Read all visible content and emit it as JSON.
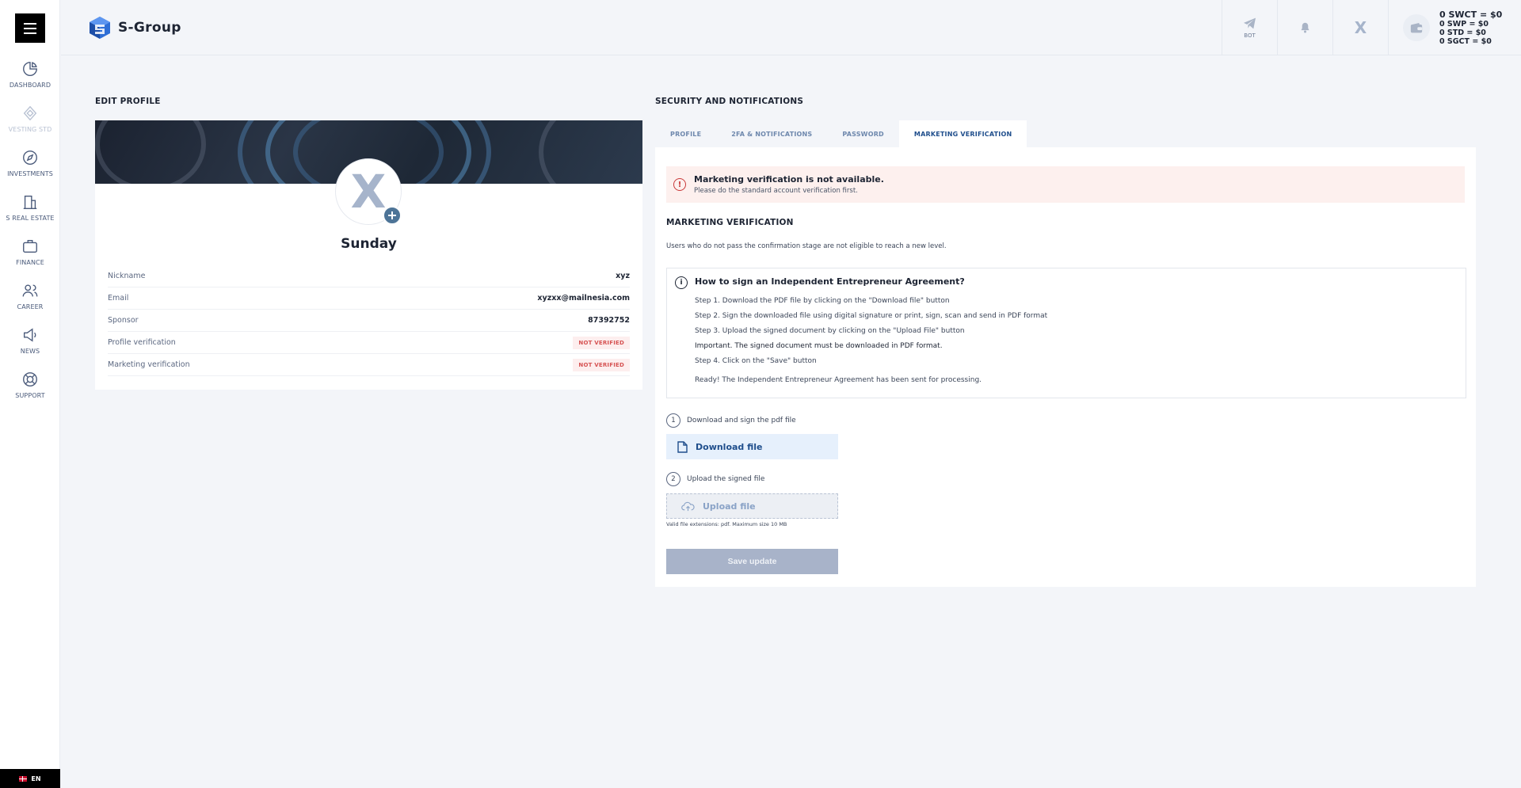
{
  "app": {
    "name": "S-Group"
  },
  "sidebar": {
    "items": [
      {
        "label": "DASHBOARD",
        "icon": "pie-chart-icon"
      },
      {
        "label": "VESTING STD",
        "icon": "diamond-icon",
        "disabled": true
      },
      {
        "label": "INVESTMENTS",
        "icon": "compass-icon"
      },
      {
        "label": "S REAL ESTATE",
        "icon": "building-icon"
      },
      {
        "label": "FINANCE",
        "icon": "briefcase-icon"
      },
      {
        "label": "CAREER",
        "icon": "users-icon"
      },
      {
        "label": "NEWS",
        "icon": "megaphone-icon"
      },
      {
        "label": "SUPPORT",
        "icon": "lifebuoy-icon"
      }
    ],
    "language": "EN"
  },
  "header": {
    "bot_label": "BOT",
    "avatar_letter": "X",
    "balances": [
      "0 SWCT = $0",
      "0 SWP = $0",
      "0 STD = $0",
      "0 SGCT = $0"
    ]
  },
  "profile": {
    "section_title": "EDIT PROFILE",
    "avatar_letter": "X",
    "name": "Sunday",
    "rows": [
      {
        "label": "Nickname",
        "value": "xyz"
      },
      {
        "label": "Email",
        "value": "xyzxx@mailnesia.com"
      },
      {
        "label": "Sponsor",
        "value": "87392752"
      },
      {
        "label": "Profile verification",
        "value": "NOT VERIFIED"
      },
      {
        "label": "Marketing verification",
        "value": "NOT VERIFIED"
      }
    ]
  },
  "security": {
    "section_title": "SECURITY AND NOTIFICATIONS",
    "tabs": [
      "PROFILE",
      "2FA & NOTIFICATIONS",
      "PASSWORD",
      "MARKETING VERIFICATION"
    ],
    "active_tab": "MARKETING VERIFICATION",
    "alert": {
      "title": "Marketing verification is not available.",
      "subtitle": "Please do the standard account verification first."
    },
    "heading": "MARKETING VERIFICATION",
    "description": "Users who do not pass the confirmation stage are not eligible to reach a new level.",
    "howto": {
      "title": "How to sign an Independent Entrepreneur Agreement?",
      "steps": [
        "Step 1. Download the PDF file by clicking on the \"Download file\" button",
        "Step 2. Sign the downloaded file using digital signature or print, sign, scan and send in PDF format",
        "Step 3. Upload the signed document by clicking on the \"Upload File\" button",
        "Important. The signed document must be downloaded in PDF format.",
        "Step 4. Click on the \"Save\" button",
        "Ready! The Independent Entrepreneur Agreement has been sent for processing."
      ]
    },
    "step1": {
      "num": "1",
      "label": "Download and sign the pdf file",
      "button": "Download file"
    },
    "step2": {
      "num": "2",
      "label": "Upload the signed file",
      "button": "Upload file",
      "hint": "Valid file extensions: pdf. Maximum size 10 MB"
    },
    "save_label": "Save update"
  },
  "colors": {
    "accent": "#1f4e8c",
    "danger": "#d65252",
    "background": "#f3f5f9"
  }
}
